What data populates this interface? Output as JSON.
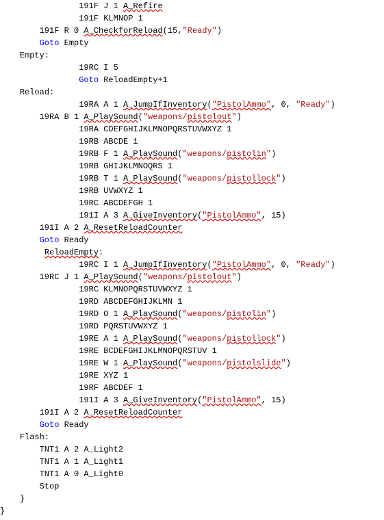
{
  "indent_unit": "    ",
  "lines": [
    {
      "indent": 4,
      "tokens": [
        {
          "t": "191F J 1 "
        },
        {
          "t": "A_Refire",
          "cls": "err"
        }
      ]
    },
    {
      "indent": 4,
      "tokens": [
        {
          "t": "191F KLMNOP 1"
        }
      ]
    },
    {
      "indent": 2,
      "tokens": [
        {
          "t": "191F R 0 "
        },
        {
          "t": "A_CheckforReload",
          "cls": "err"
        },
        {
          "t": "(15,"
        },
        {
          "t": "\"Ready\"",
          "cls": "str"
        },
        {
          "t": ")"
        }
      ]
    },
    {
      "indent": 2,
      "tokens": [
        {
          "t": "Goto",
          "cls": "kw"
        },
        {
          "t": " Empty"
        }
      ]
    },
    {
      "indent": 1,
      "tokens": [
        {
          "t": "Empty:"
        }
      ]
    },
    {
      "indent": 4,
      "tokens": [
        {
          "t": "19RC I 5"
        }
      ]
    },
    {
      "indent": 4,
      "tokens": [
        {
          "t": "Goto",
          "cls": "kw"
        },
        {
          "t": " ReloadEmpty+1"
        }
      ]
    },
    {
      "indent": 1,
      "tokens": [
        {
          "t": "Reload:"
        }
      ]
    },
    {
      "indent": 4,
      "tokens": [
        {
          "t": "19RA A 1 "
        },
        {
          "t": "A_JumpIfInventory",
          "cls": "err"
        },
        {
          "t": "("
        },
        {
          "t": "\"PistolAmmo\"",
          "cls": "str err"
        },
        {
          "t": ", 0, "
        },
        {
          "t": "\"Ready\"",
          "cls": "str"
        },
        {
          "t": ")"
        }
      ]
    },
    {
      "indent": 2,
      "tokens": [
        {
          "t": "19RA B 1 "
        },
        {
          "t": "A_PlaySound",
          "cls": "err"
        },
        {
          "t": "("
        },
        {
          "t": "\"weapons/",
          "cls": "str"
        },
        {
          "t": "pistolout",
          "cls": "str err"
        },
        {
          "t": "\"",
          "cls": "str"
        },
        {
          "t": ")"
        }
      ]
    },
    {
      "indent": 4,
      "tokens": [
        {
          "t": "19RA CDEFGHIJKLMNOPQRSTUVWXYZ 1"
        }
      ]
    },
    {
      "indent": 4,
      "tokens": [
        {
          "t": "19RB ABCDE 1"
        }
      ]
    },
    {
      "indent": 4,
      "tokens": [
        {
          "t": "19RB F 1 "
        },
        {
          "t": "A_PlaySound",
          "cls": "err"
        },
        {
          "t": "("
        },
        {
          "t": "\"weapons/",
          "cls": "str"
        },
        {
          "t": "pistolin",
          "cls": "str err"
        },
        {
          "t": "\"",
          "cls": "str"
        },
        {
          "t": ")"
        }
      ]
    },
    {
      "indent": 4,
      "tokens": [
        {
          "t": "19RB GHIJKLMNOQRS 1"
        }
      ]
    },
    {
      "indent": 4,
      "tokens": [
        {
          "t": "19RB T 1 "
        },
        {
          "t": "A_PlaySound",
          "cls": "err"
        },
        {
          "t": "("
        },
        {
          "t": "\"weapons/",
          "cls": "str"
        },
        {
          "t": "pistollock",
          "cls": "str err"
        },
        {
          "t": "\"",
          "cls": "str"
        },
        {
          "t": ")"
        }
      ]
    },
    {
      "indent": 4,
      "tokens": [
        {
          "t": "19RB UVWXYZ 1"
        }
      ]
    },
    {
      "indent": 4,
      "tokens": [
        {
          "t": "19RC ABCDEFGH 1"
        }
      ]
    },
    {
      "indent": 4,
      "tokens": [
        {
          "t": "191I A 3 "
        },
        {
          "t": "A_GiveInventory",
          "cls": "err"
        },
        {
          "t": "("
        },
        {
          "t": "\"PistolAmmo\"",
          "cls": "str err"
        },
        {
          "t": ", 15)"
        }
      ]
    },
    {
      "indent": 2,
      "tokens": [
        {
          "t": "191I A 2 "
        },
        {
          "t": "A_ResetReloadCounter",
          "cls": "err"
        }
      ]
    },
    {
      "indent": 2,
      "tokens": [
        {
          "t": "Goto",
          "cls": "kw"
        },
        {
          "t": " Ready"
        }
      ]
    },
    {
      "indent": 2,
      "tokens": [
        {
          "t": " "
        },
        {
          "t": "ReloadEmpty",
          "cls": "err"
        },
        {
          "t": ":"
        }
      ]
    },
    {
      "indent": 4,
      "tokens": [
        {
          "t": "19RC I 1 "
        },
        {
          "t": "A_JumpIfInventory",
          "cls": "err"
        },
        {
          "t": "("
        },
        {
          "t": "\"PistolAmmo\"",
          "cls": "str err"
        },
        {
          "t": ", 0, "
        },
        {
          "t": "\"Ready\"",
          "cls": "str"
        },
        {
          "t": ")"
        }
      ]
    },
    {
      "indent": 2,
      "tokens": [
        {
          "t": "19RC J 1 "
        },
        {
          "t": "A_PlaySound",
          "cls": "err"
        },
        {
          "t": "("
        },
        {
          "t": "\"weapons/",
          "cls": "str"
        },
        {
          "t": "pistolout",
          "cls": "str err"
        },
        {
          "t": "\"",
          "cls": "str"
        },
        {
          "t": ")"
        }
      ]
    },
    {
      "indent": 4,
      "tokens": [
        {
          "t": "19RC KLMNOPQRSTUVWXYZ 1"
        }
      ]
    },
    {
      "indent": 4,
      "tokens": [
        {
          "t": "19RD ABCDEFGHIJKLMN 1"
        }
      ]
    },
    {
      "indent": 4,
      "tokens": [
        {
          "t": "19RD O 1 "
        },
        {
          "t": "A_PlaySound",
          "cls": "err"
        },
        {
          "t": "("
        },
        {
          "t": "\"weapons/",
          "cls": "str"
        },
        {
          "t": "pistolin",
          "cls": "str err"
        },
        {
          "t": "\"",
          "cls": "str"
        },
        {
          "t": ")"
        }
      ]
    },
    {
      "indent": 4,
      "tokens": [
        {
          "t": "19RD PQRSTUVWXYZ 1"
        }
      ]
    },
    {
      "indent": 4,
      "tokens": [
        {
          "t": "19RE A 1 "
        },
        {
          "t": "A_PlaySound",
          "cls": "err"
        },
        {
          "t": "("
        },
        {
          "t": "\"weapons/",
          "cls": "str"
        },
        {
          "t": "pistollock",
          "cls": "str err"
        },
        {
          "t": "\"",
          "cls": "str"
        },
        {
          "t": ")"
        }
      ]
    },
    {
      "indent": 4,
      "tokens": [
        {
          "t": "19RE BCDEFGHIJKLMNOPQRSTUV 1"
        }
      ]
    },
    {
      "indent": 4,
      "tokens": [
        {
          "t": "19RE W 1 "
        },
        {
          "t": "A_PlaySound",
          "cls": "err"
        },
        {
          "t": "("
        },
        {
          "t": "\"weapons/",
          "cls": "str"
        },
        {
          "t": "pistolslide",
          "cls": "str err"
        },
        {
          "t": "\"",
          "cls": "str"
        },
        {
          "t": ")"
        }
      ]
    },
    {
      "indent": 4,
      "tokens": [
        {
          "t": "19RE XYZ 1"
        }
      ]
    },
    {
      "indent": 4,
      "tokens": [
        {
          "t": "19RF ABCDEF 1"
        }
      ]
    },
    {
      "indent": 4,
      "tokens": [
        {
          "t": "191I A 3 "
        },
        {
          "t": "A_GiveInventory",
          "cls": "err"
        },
        {
          "t": "("
        },
        {
          "t": "\"PistolAmmo\"",
          "cls": "str err"
        },
        {
          "t": ", 15)"
        }
      ]
    },
    {
      "indent": 2,
      "tokens": [
        {
          "t": "191I A 2 "
        },
        {
          "t": "A_ResetReloadCounter",
          "cls": "err"
        }
      ]
    },
    {
      "indent": 2,
      "tokens": [
        {
          "t": "Goto",
          "cls": "kw"
        },
        {
          "t": " Ready"
        }
      ]
    },
    {
      "indent": 1,
      "tokens": [
        {
          "t": "Flash:"
        }
      ]
    },
    {
      "indent": 2,
      "tokens": [
        {
          "t": "TNT1 A 2 A_Light2"
        }
      ]
    },
    {
      "indent": 2,
      "tokens": [
        {
          "t": "TNT1 A 1 A_Light1"
        }
      ]
    },
    {
      "indent": 2,
      "tokens": [
        {
          "t": "TNT1 A 0 A_Light0"
        }
      ]
    },
    {
      "indent": 2,
      "tokens": [
        {
          "t": "Stop"
        }
      ]
    },
    {
      "indent": 1,
      "tokens": [
        {
          "t": "}"
        }
      ]
    },
    {
      "indent": 0,
      "tokens": [
        {
          "t": "}"
        }
      ]
    }
  ]
}
